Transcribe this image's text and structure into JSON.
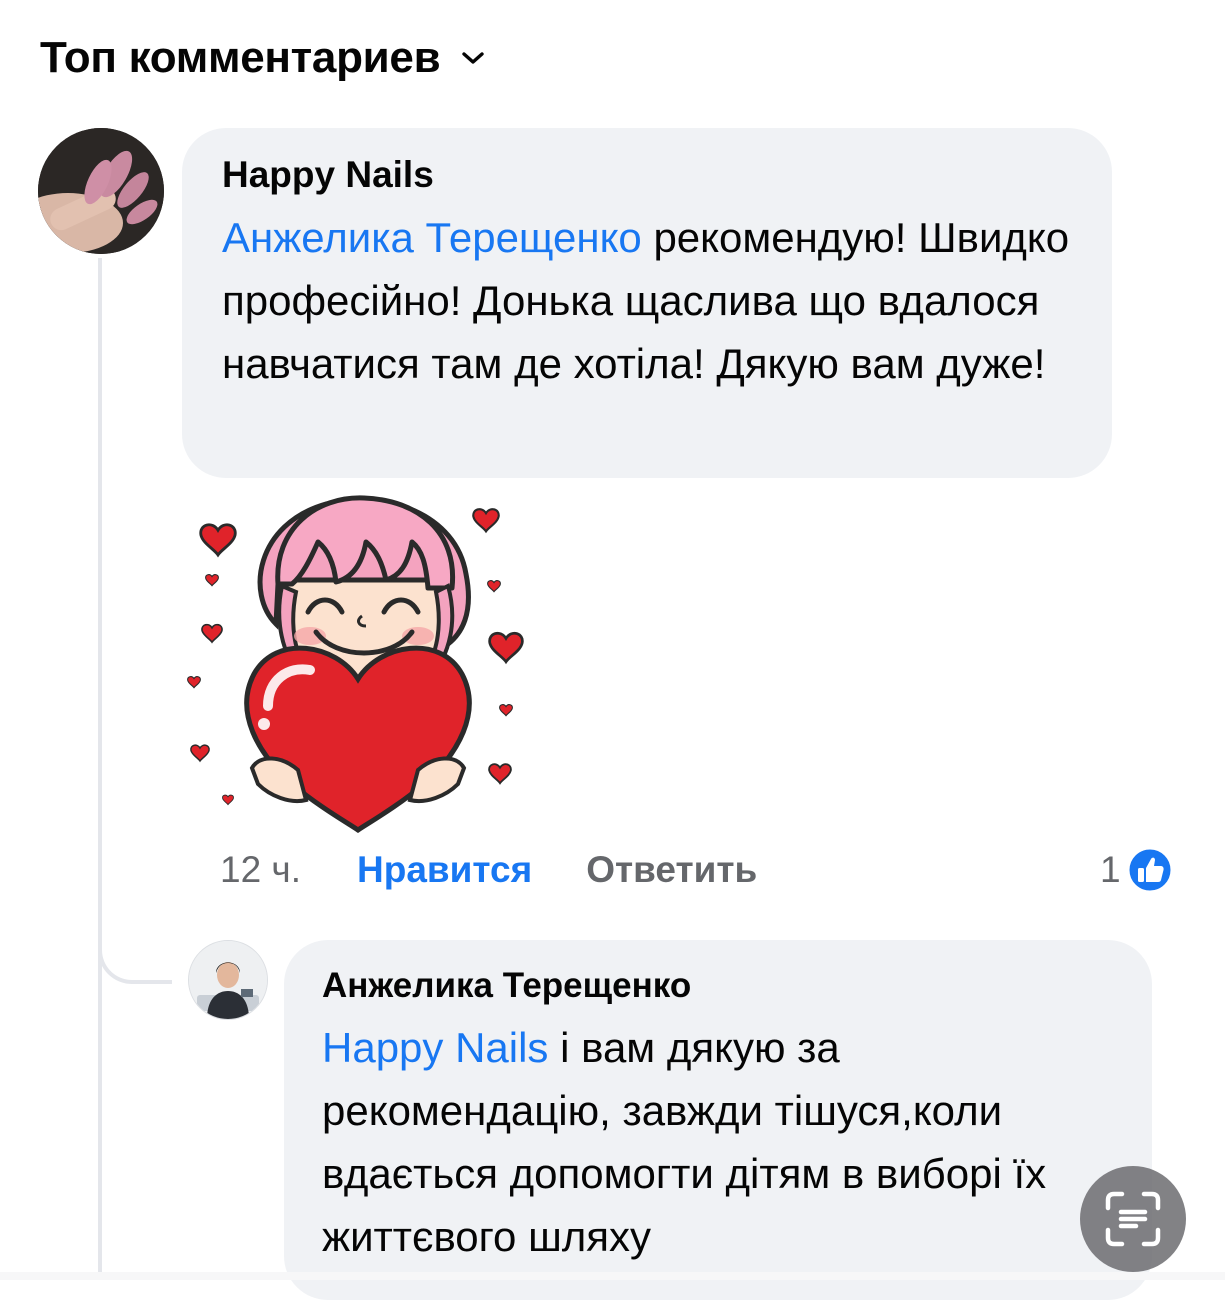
{
  "header": {
    "title": "Топ комментариев",
    "dropdown_icon": "chevron-down-icon"
  },
  "comments": [
    {
      "author": "Happy Nails",
      "mention": "Анжелика Терещенко",
      "text": " рекомендую! Швидко професійно! Донька щаслива що вдалося навчатися там де хотіла! Дякую вам дуже!",
      "sticker": "girl-holding-heart-sticker",
      "time": "12 ч.",
      "like_label": "Нравится",
      "reply_label": "Ответить",
      "reaction_count": "1",
      "reaction_icon": "like-icon"
    },
    {
      "author": "Анжелика Терещенко",
      "mention": "Happy Nails",
      "text": " і вам дякую за рекомендацію, завжди тішуся,коли вдається допомогти дітям в виборі їх життєвого шляху"
    }
  ],
  "colors": {
    "link": "#1877f2",
    "bubble": "#f0f2f5",
    "muted": "#65676b",
    "text": "#050505"
  }
}
